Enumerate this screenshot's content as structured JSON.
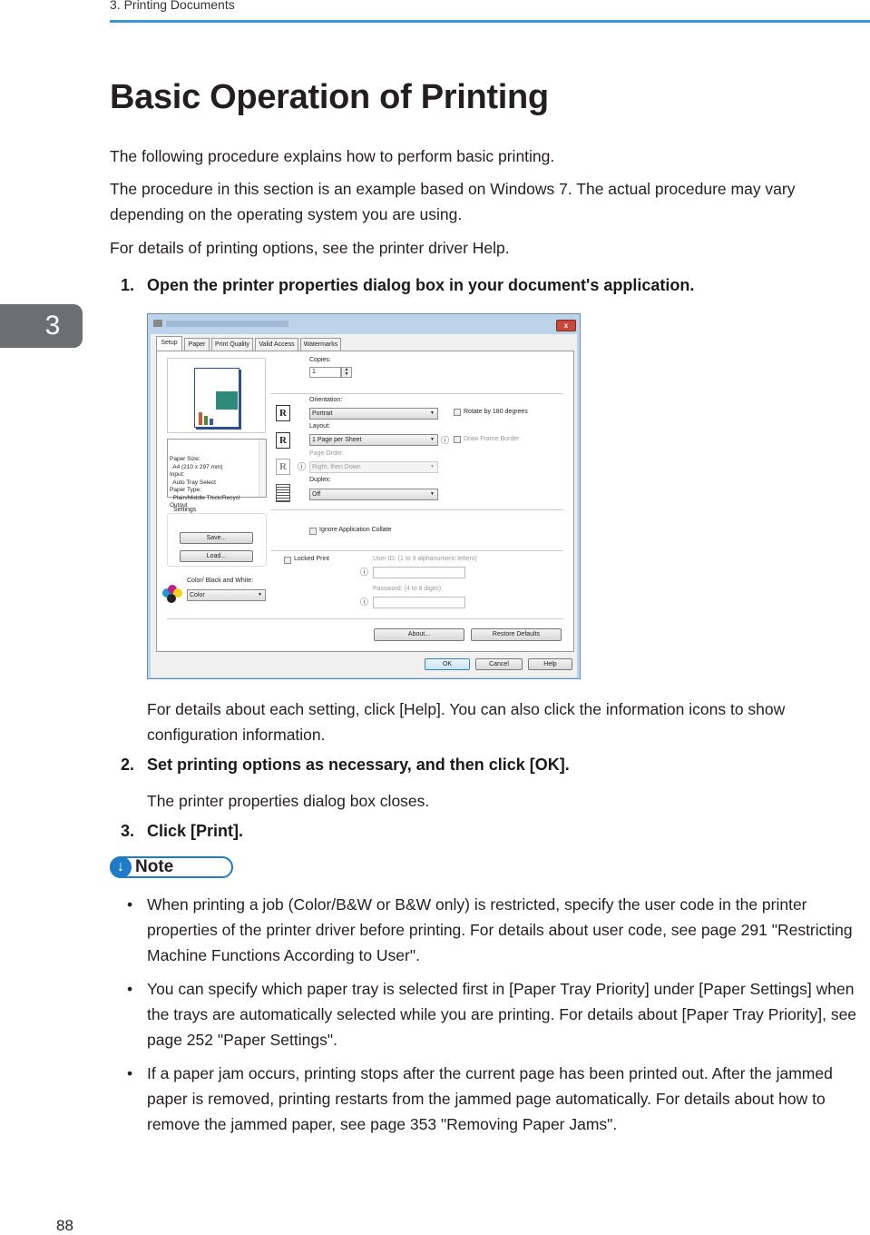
{
  "header": {
    "chapter_title": "3. Printing Documents",
    "chapter_number": "3",
    "accent": "#3a9ad9"
  },
  "title": "Basic Operation of Printing",
  "intro": [
    "The following procedure explains how to perform basic printing.",
    "The procedure in this section is an example based on Windows 7. The actual procedure may vary depending on the operating system you are using.",
    "For details of printing options, see the printer driver Help."
  ],
  "steps": [
    {
      "num": "1.",
      "text": "Open the printer properties dialog box in your document's application.",
      "detail": "For details about each setting, click [Help]. You can also click the information icons to show configuration information."
    },
    {
      "num": "2.",
      "text": "Set printing options as necessary, and then click [OK].",
      "detail": "The printer properties dialog box closes."
    },
    {
      "num": "3.",
      "text": "Click [Print]."
    }
  ],
  "dialog": {
    "tabs": [
      "Setup",
      "Paper",
      "Print Quality",
      "Valid Access",
      "Watermarks"
    ],
    "close": "x",
    "info_list": [
      "Paper Size:",
      "  A4 (210 x 297 mm)",
      "Input:",
      "  Auto Tray Select",
      "Paper Type:",
      "  Plain/Middle Thick/Recycl",
      "Output"
    ],
    "copies_label": "Copies:",
    "copies_value": "1",
    "orientation_label": "Orientation:",
    "orientation_value": "Portrait",
    "rotate_label": "Rotate by 180 degrees",
    "layout_label": "Layout:",
    "layout_value": "1 Page per Sheet",
    "frame_label": "Draw Frame Border",
    "page_order_label": "Page Order:",
    "page_order_value": "Right, then Down",
    "duplex_label": "Duplex:",
    "duplex_value": "Off",
    "settings_label": "Settings",
    "save": "Save...",
    "load": "Load...",
    "collate_label": "Ignore Application Collate",
    "locked_label": "Locked Print",
    "userid_label": "User ID: (1 to 9 alphanumeric letters)",
    "password_label": "Password: (4 to 8 digits)",
    "color_label": "Color/ Black and White:",
    "color_value": "Color",
    "about": "About...",
    "restore": "Restore Defaults",
    "ok": "OK",
    "cancel": "Cancel",
    "help": "Help",
    "orient_icon": "R"
  },
  "note": {
    "label": "Note",
    "items": [
      "When printing a job (Color/B&W or B&W only) is restricted, specify the user code in the printer properties of the printer driver before printing. For details about user code, see page 291 \"Restricting Machine Functions According to User\".",
      "You can specify which paper tray is selected first in [Paper Tray Priority] under [Paper Settings] when the trays are automatically selected while you are printing. For details about [Paper Tray Priority], see page 252 \"Paper Settings\".",
      "If a paper jam occurs, printing stops after the current page has been printed out. After the jammed paper is removed, printing restarts from the jammed page automatically. For details about how to remove the jammed paper, see page 353 \"Removing Paper Jams\"."
    ]
  },
  "page_number": "88"
}
